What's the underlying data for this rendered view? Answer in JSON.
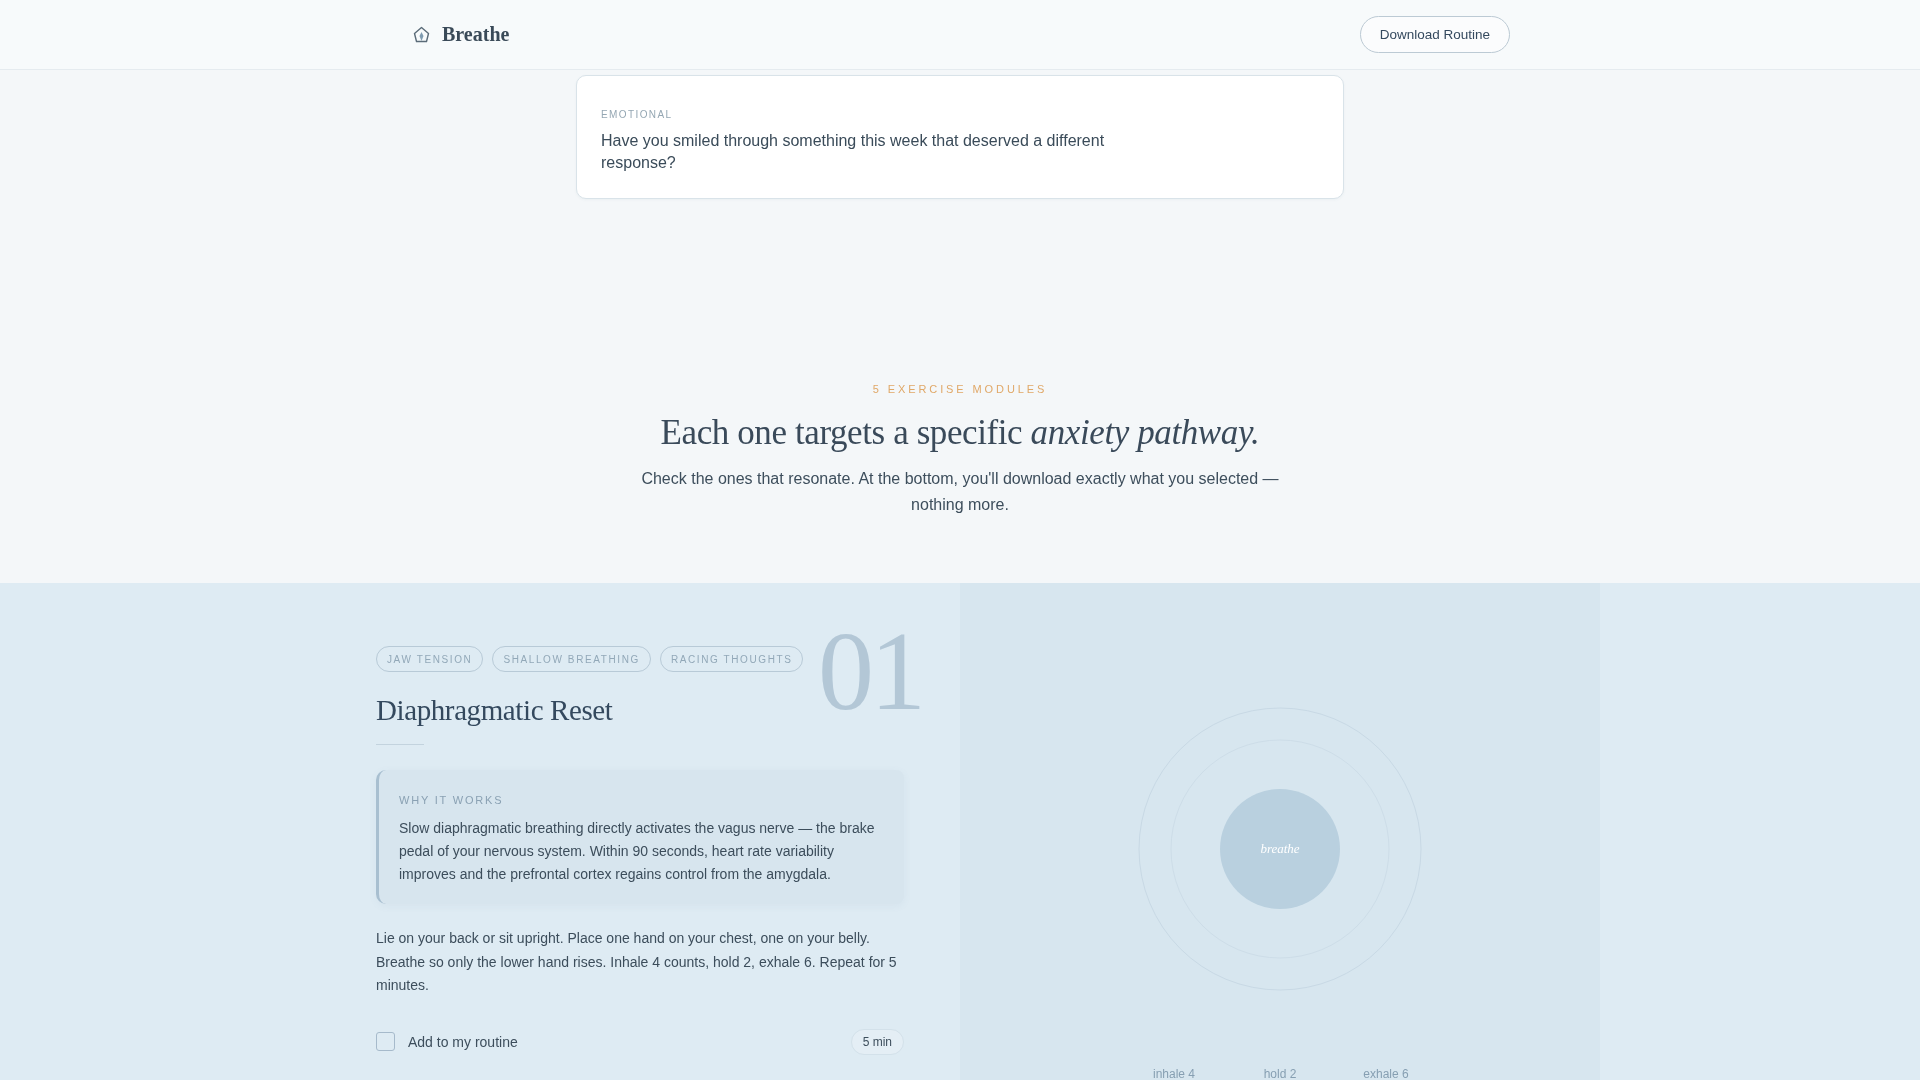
{
  "header": {
    "brand": "Breathe",
    "button": "Download Routine"
  },
  "prompt_card": {
    "category": "EMOTIONAL",
    "question": "Have you smiled through something this week that deserved a different response?"
  },
  "intro": {
    "eyebrow": "5 EXERCISE MODULES",
    "heading": "Each one targets a specific *anxiety pathway.*",
    "text": "Check the ones that resonate. At the bottom, you'll download exactly what you selected — nothing more."
  },
  "modules": [
    {
      "number": "01",
      "tags": [
        "JAW TENSION",
        "SHALLOW BREATHING",
        "RACING THOUGHTS"
      ],
      "title": "Diaphragmatic Reset",
      "why_label": "WHY IT WORKS",
      "why_text": "Slow diaphragmatic breathing directly activates the vagus nerve — the brake pedal of your nervous system. Within 90 seconds, heart rate variability improves and the prefrontal cortex regains control from the amygdala.",
      "instructions": "Lie on your back or sit upright. Place one hand on your chest, one on your belly. Breathe so only the lower hand rises. Inhale 4 counts, hold 2, exhale 6. Repeat for 5 minutes.",
      "checkbox_label": "Add to my routine",
      "checked": false,
      "duration": "5 min",
      "visual": {
        "orb_label": "breathe",
        "phases": [
          "inhale 4",
          "hold 2",
          "exhale 6"
        ]
      }
    }
  ]
}
